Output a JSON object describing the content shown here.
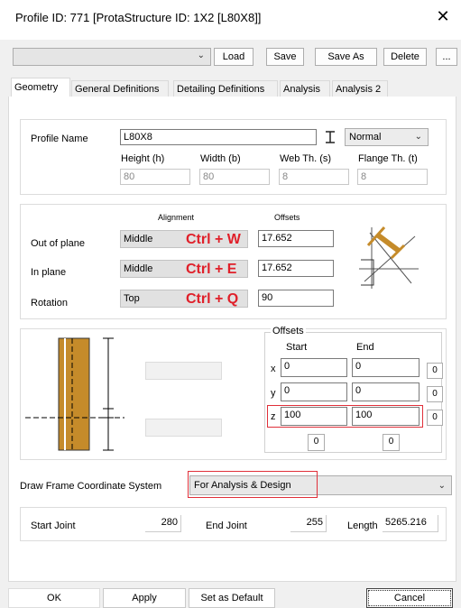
{
  "window": {
    "title": "Profile ID: 771 [ProtaStructure ID: 1X2 [L80X8]]",
    "close": "✕"
  },
  "toolbar": {
    "combo_value": "",
    "load": "Load",
    "save": "Save",
    "save_as": "Save As",
    "delete": "Delete",
    "more": "..."
  },
  "tabs": [
    {
      "label": "Geometry"
    },
    {
      "label": "General Definitions"
    },
    {
      "label": "Detailing Definitions"
    },
    {
      "label": "Analysis"
    },
    {
      "label": "Analysis 2"
    }
  ],
  "profile": {
    "name_label": "Profile Name",
    "name_value": "L80X8",
    "type_value": "Normal",
    "height_label": "Height (h)",
    "height_value": "80",
    "width_label": "Width (b)",
    "width_value": "80",
    "web_label": "Web Th. (s)",
    "web_value": "8",
    "flange_label": "Flange Th. (t)",
    "flange_value": "8"
  },
  "alignment": {
    "alignment_header": "Alignment",
    "offsets_header": "Offsets",
    "rows": [
      {
        "label": "Out of plane",
        "alignment": "Middle",
        "shortcut": "Ctrl + W",
        "offset": "17.652"
      },
      {
        "label": "In plane",
        "alignment": "Middle",
        "shortcut": "Ctrl + E",
        "offset": "17.652"
      },
      {
        "label": "Rotation",
        "alignment": "Top",
        "shortcut": "Ctrl + Q",
        "offset": "90"
      }
    ]
  },
  "offsets": {
    "title": "Offsets",
    "start_header": "Start",
    "end_header": "End",
    "rows": [
      {
        "axis": "x",
        "start": "0",
        "end": "0",
        "btn": "0"
      },
      {
        "axis": "y",
        "start": "0",
        "end": "0",
        "btn": "0"
      },
      {
        "axis": "z",
        "start": "100",
        "end": "100",
        "btn": "0"
      }
    ],
    "start_btn": "0",
    "end_btn": "0"
  },
  "frame": {
    "label": "Draw Frame Coordinate System",
    "value": "For Analysis & Design"
  },
  "joints": {
    "start_label": "Start Joint",
    "start_value": "280",
    "end_label": "End Joint",
    "end_value": "255",
    "length_label": "Length",
    "length_value": "5265.216"
  },
  "footer": {
    "ok": "OK",
    "apply": "Apply",
    "set_default": "Set as Default",
    "cancel": "Cancel"
  },
  "colors": {
    "accent_red": "#e0202a",
    "steel": "#c58b2a"
  }
}
